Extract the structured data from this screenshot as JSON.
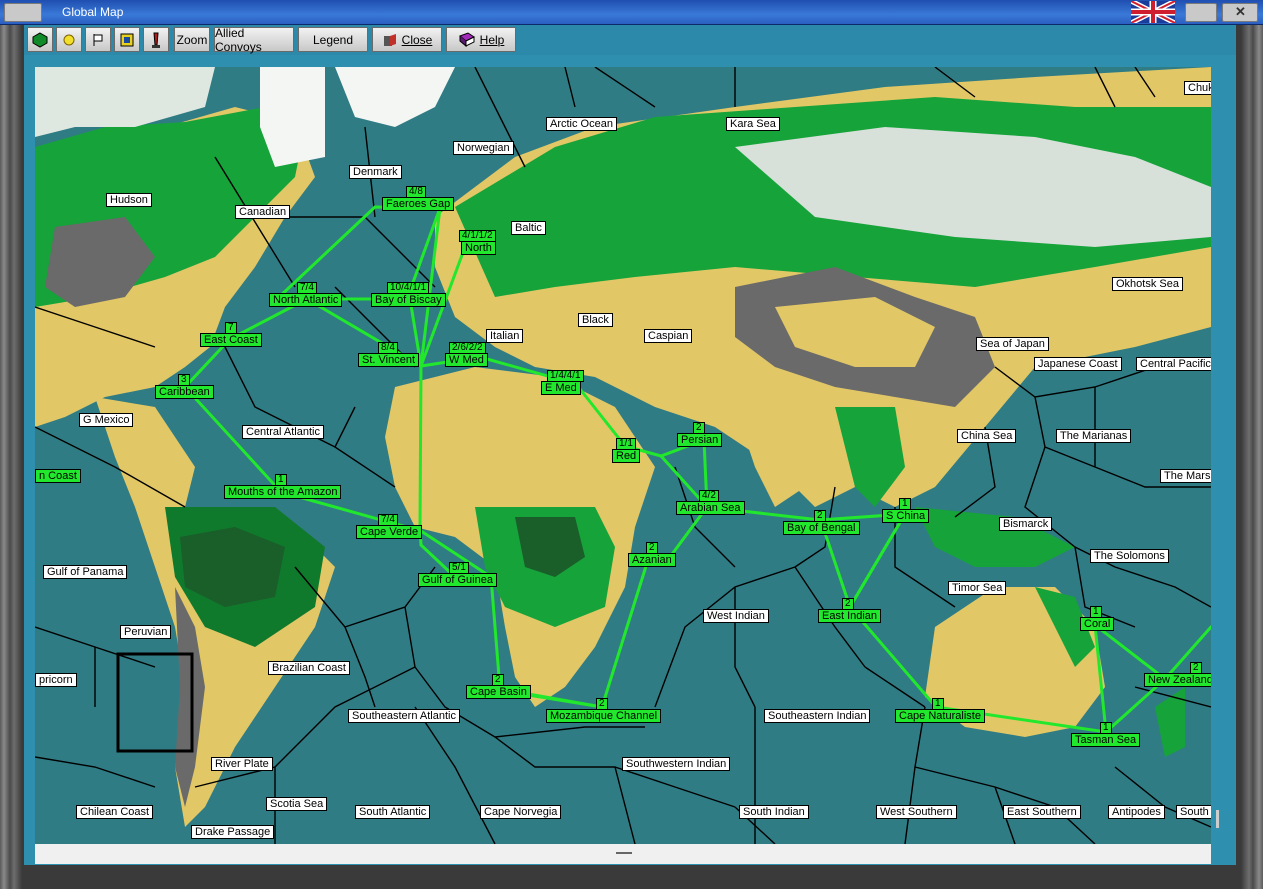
{
  "window": {
    "title": "Global Map"
  },
  "toolbar": {
    "buttons": [
      {
        "label": "",
        "icon": "hex-green-icon"
      },
      {
        "label": "",
        "icon": "sun-icon"
      },
      {
        "label": "",
        "icon": "flag-icon"
      },
      {
        "label": "",
        "icon": "grid-icon"
      },
      {
        "label": "",
        "icon": "pen-icon"
      },
      {
        "label": "Zoom",
        "icon": ""
      },
      {
        "label": "Allied Convoys",
        "icon": ""
      },
      {
        "label": "Legend",
        "icon": ""
      },
      {
        "label": "Close",
        "icon": "close-icon"
      },
      {
        "label": "Help",
        "icon": "book-icon"
      }
    ]
  },
  "colors": {
    "ocean": "#307c84",
    "convoy": "#21e82c",
    "route": "#21e82c",
    "forest": "#15a33a",
    "desert": "#e2c766",
    "mountain": "#6a6a6a",
    "ice": "#f0f0f0"
  },
  "sea_zones": [
    "Chuk",
    "Arctic Ocean",
    "Kara Sea",
    "Norwegian",
    "Denmark",
    "Hudson",
    "Canadian",
    "Baltic",
    "Okhotsk Sea",
    "Italian",
    "Black",
    "Caspian",
    "Sea of Japan",
    "Japanese Coast",
    "Central Pacific",
    "G Mexico",
    "Central Atlantic",
    "China Sea",
    "The Marianas",
    "The Marsh",
    "Bismarck",
    "The Solomons",
    "Timor Sea",
    "Gulf of Panama",
    "Peruvian",
    "West Indian",
    "Brazilian Coast",
    "pricorn",
    "Southeastern Atlantic",
    "Southeastern Indian",
    "River Plate",
    "Southwestern Indian",
    "Scotia Sea",
    "Chilean Coast",
    "South Atlantic",
    "Cape Norvegia",
    "South Indian",
    "West Southern",
    "East Southern",
    "Antipodes",
    "South",
    "Drake Passage"
  ],
  "convoy_zones": [
    {
      "name": "Faeroes Gap",
      "count": "4/8"
    },
    {
      "name": "North",
      "count": "4/1/1/2"
    },
    {
      "name": "North Atlantic",
      "count": "7/4"
    },
    {
      "name": "Bay of Biscay",
      "count": "10/4/1/1"
    },
    {
      "name": "East Coast",
      "count": "7"
    },
    {
      "name": "St. Vincent",
      "count": "8/4"
    },
    {
      "name": "W Med",
      "count": "2/6/2/2"
    },
    {
      "name": "E Med",
      "count": "1/4/4/1"
    },
    {
      "name": "Caribbean",
      "count": "3"
    },
    {
      "name": "Red",
      "count": "1/1"
    },
    {
      "name": "Persian",
      "count": "2"
    },
    {
      "name": "n Coast",
      "count": ""
    },
    {
      "name": "Mouths of the Amazon",
      "count": "1"
    },
    {
      "name": "Arabian Sea",
      "count": "4/2"
    },
    {
      "name": "Bay of Bengal",
      "count": "2"
    },
    {
      "name": "S China",
      "count": "1"
    },
    {
      "name": "Cape Verde",
      "count": "7/4"
    },
    {
      "name": "Azanian",
      "count": "2"
    },
    {
      "name": "Gulf of Guinea",
      "count": "5/1"
    },
    {
      "name": "East Indian",
      "count": "2"
    },
    {
      "name": "Coral",
      "count": "1"
    },
    {
      "name": "New Zealand",
      "count": "2"
    },
    {
      "name": "Cape Basin",
      "count": "2"
    },
    {
      "name": "Mozambique Channel",
      "count": "2"
    },
    {
      "name": "Cape Naturaliste",
      "count": "1"
    },
    {
      "name": "Tasman Sea",
      "count": "1"
    }
  ]
}
